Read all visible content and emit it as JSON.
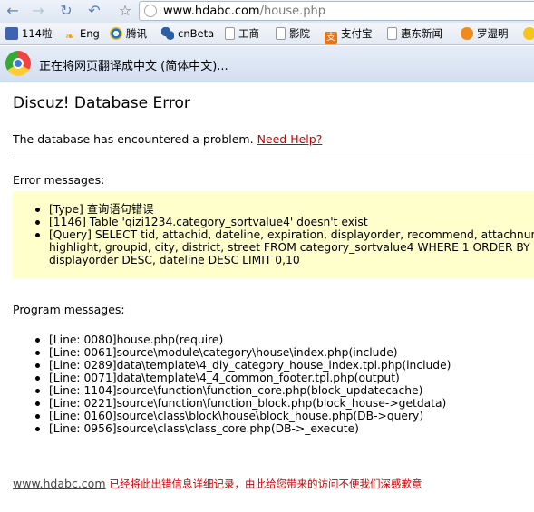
{
  "browser": {
    "url_host": "www.hdabc.com",
    "url_path": "/house.php",
    "bookmarks": [
      "114啦",
      "Eng",
      "腾讯",
      "cnBeta",
      "工商",
      "影院",
      "支付宝",
      "惠东新闻",
      "罗湿明"
    ]
  },
  "translate_bar": {
    "message": "正在将网页翻译成中文 (简体中文)..."
  },
  "page": {
    "title": "Discuz! Database Error",
    "description": "The database has encountered a problem.",
    "help_link": "Need Help?",
    "errors_heading": "Error messages:",
    "errors": [
      "[Type] 查询语句错误",
      "[1146] Table 'qizi1234.category_sortvalue4' doesn't exist",
      "[Query] SELECT tid, attachid, dateline, expiration, displayorder, recommend, attachnum,",
      "highlight, groupid, city, district, street FROM category_sortvalue4 WHERE 1 ORDER BY",
      "displayorder DESC, dateline DESC LIMIT 0,10"
    ],
    "program_heading": "Program messages:",
    "program": [
      "[Line: 0080]house.php(require)",
      "[Line: 0061]source\\module\\category\\house\\index.php(include)",
      "[Line: 0289]data\\template\\4_diy_category_house_index.tpl.php(include)",
      "[Line: 0071]data\\template\\4_4_common_footer.tpl.php(output)",
      "[Line: 1104]source\\function\\function_core.php(block_updatecache)",
      "[Line: 0221]source\\function\\function_block.php(block_house->getdata)",
      "[Line: 0160]source\\class\\block\\house\\block_house.php(DB->query)",
      "[Line: 0956]source\\class\\class_core.php(DB->_execute)"
    ],
    "footer_link": "www.hdabc.com",
    "footer_text": "已经将此出错信息详细记录，由此给您带来的访问不便我们深感歉意"
  }
}
